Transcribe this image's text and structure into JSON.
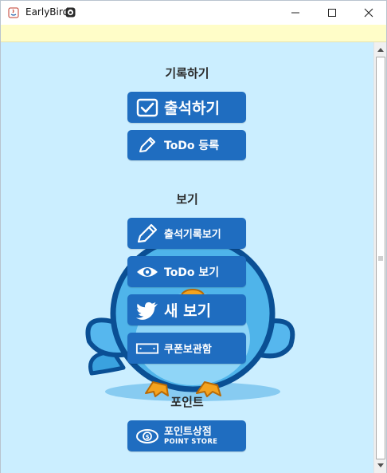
{
  "window": {
    "title": "EarlyBird",
    "controls": {
      "minimize": "minimize",
      "maximize": "maximize",
      "close": "close"
    }
  },
  "sections": {
    "record": {
      "label": "기록하기",
      "attendance_button": "출석하기",
      "todo_register_button": "ToDo 등록"
    },
    "view": {
      "label": "보기",
      "attendance_history_button": "출석기록보기",
      "todo_view_button": "ToDo 보기",
      "bird_view_button": "새 보기",
      "coupon_box_button": "쿠폰보관함"
    },
    "point": {
      "label": "포인트",
      "store_button_main": "포인트상점",
      "store_button_sub": "POINT STORE"
    }
  },
  "colors": {
    "background": "#cbeeff",
    "button": "#1f6dc0",
    "notice_strip": "#fffdc8",
    "bird_body": "#4fb4ea",
    "bird_outline": "#0a4f94",
    "bird_feet": "#f4a31f"
  },
  "icons": {
    "attendance": "checkbox-icon",
    "todo_register": "pencil-icon",
    "attendance_history": "pencil-icon",
    "todo_view": "eye-icon",
    "bird_view": "bird-icon",
    "coupon_box": "ticket-icon",
    "point_store": "coin-icon"
  }
}
